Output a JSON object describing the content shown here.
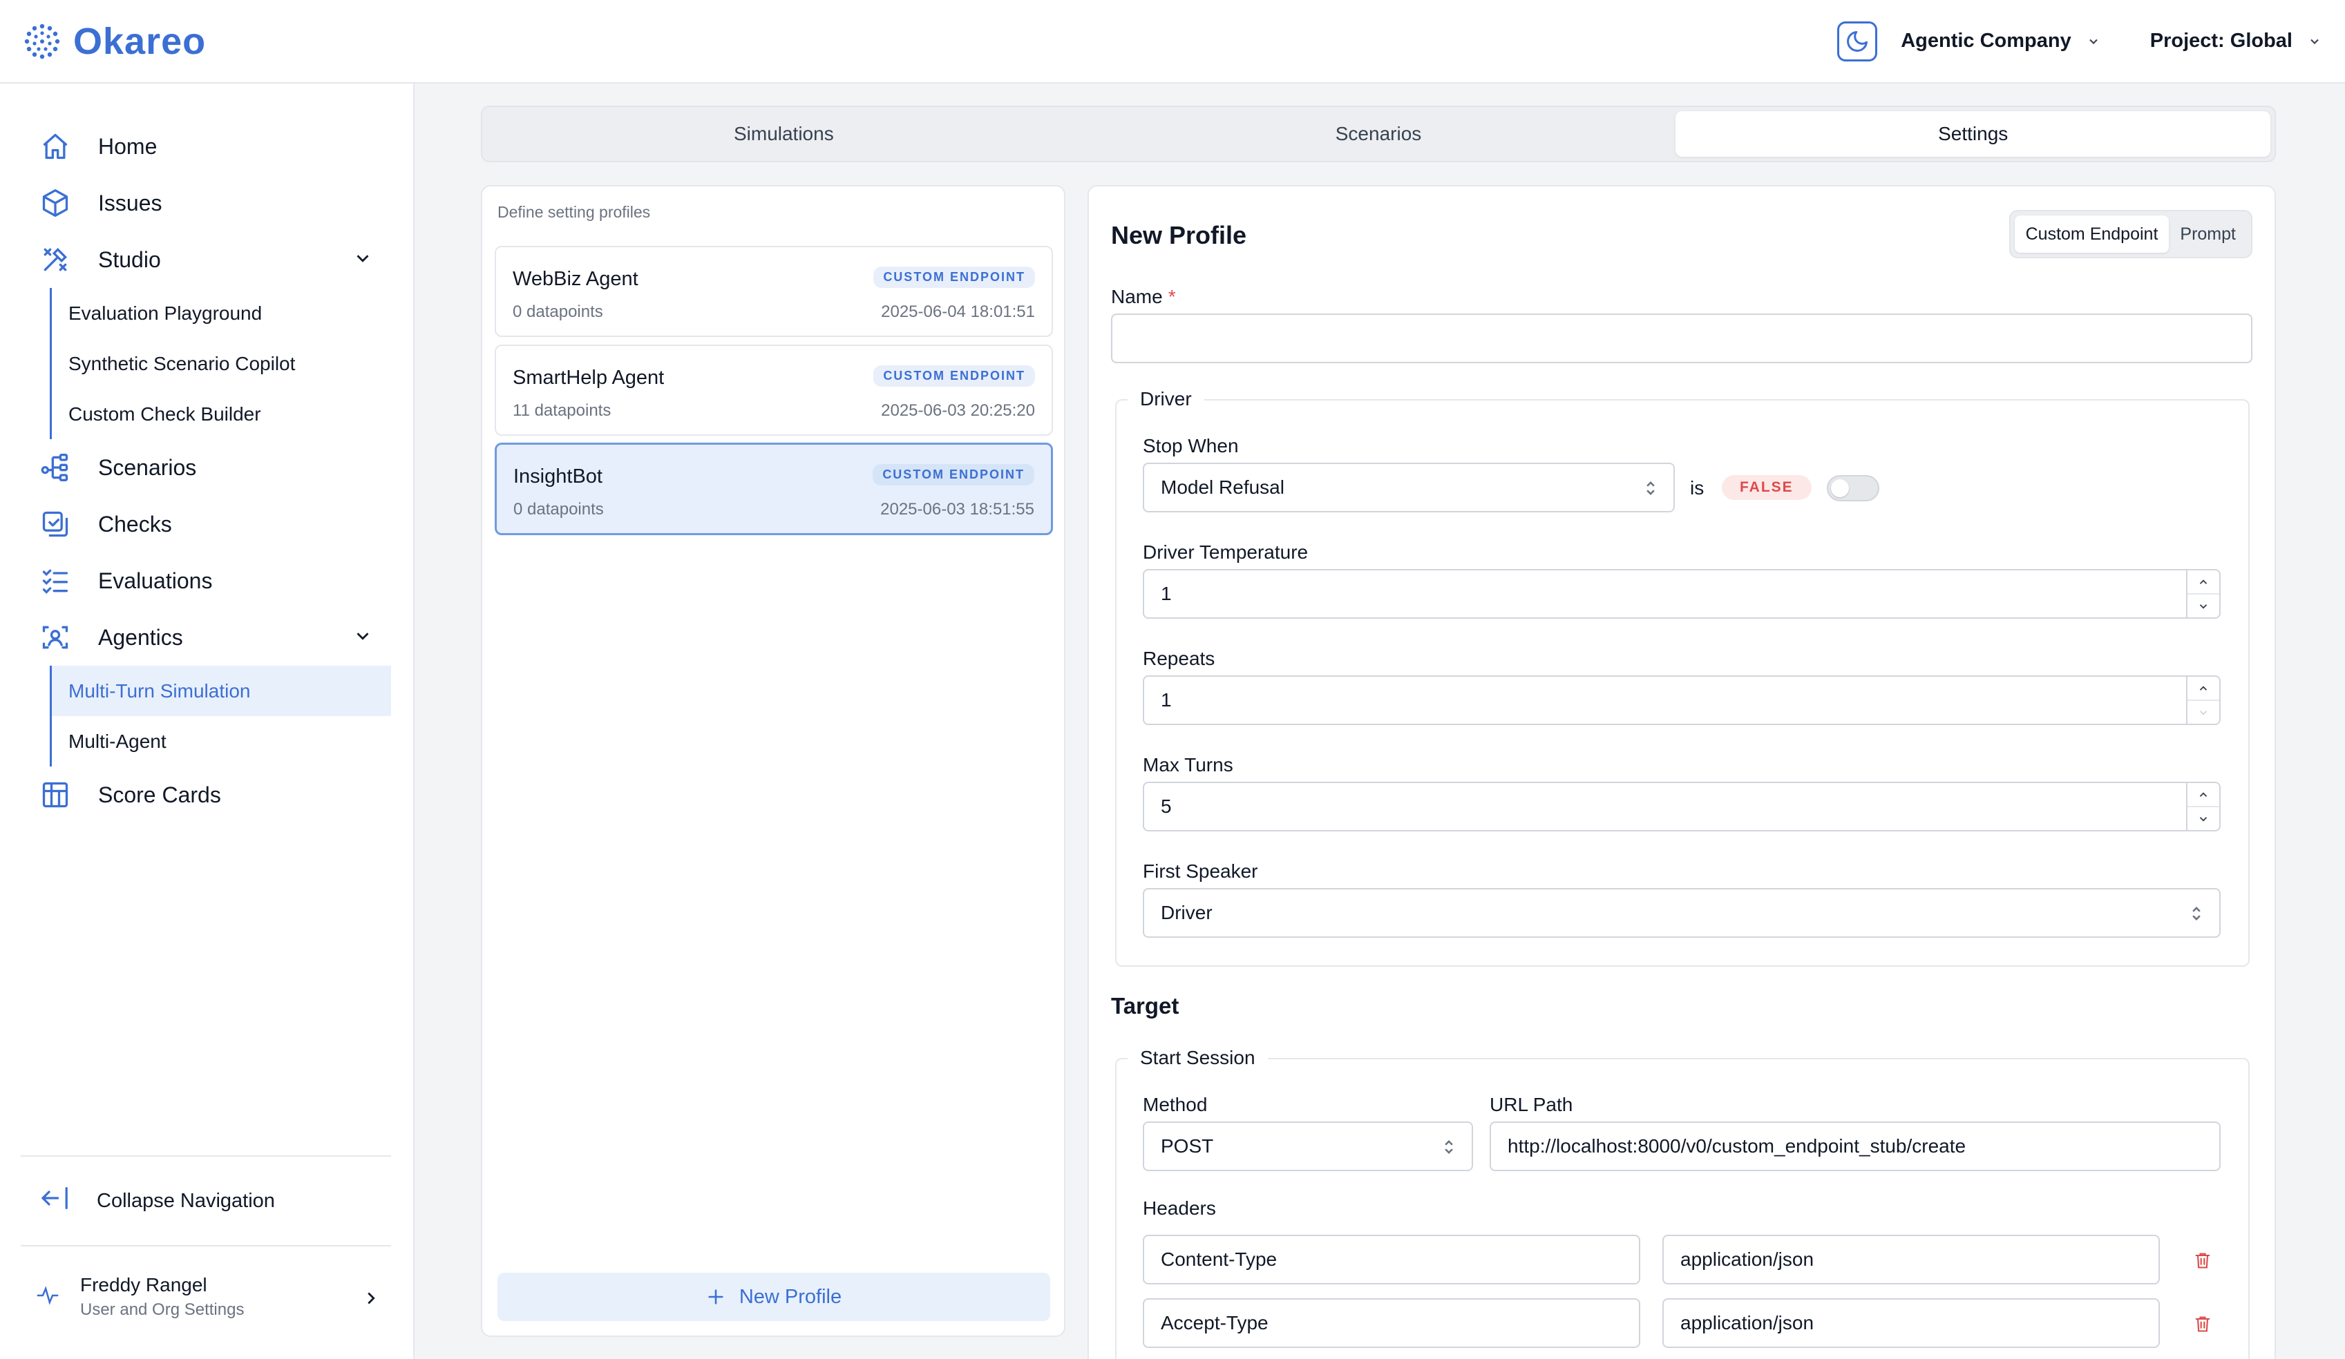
{
  "app": {
    "brand": "Okareo"
  },
  "topbar": {
    "org": "Agentic Company",
    "project": "Project: Global"
  },
  "sidebar": {
    "items": [
      {
        "label": "Home",
        "icon": "home-icon"
      },
      {
        "label": "Issues",
        "icon": "cube-icon"
      },
      {
        "label": "Studio",
        "icon": "tools-icon",
        "expanded": true,
        "children": [
          "Evaluation Playground",
          "Synthetic Scenario Copilot",
          "Custom Check Builder"
        ]
      },
      {
        "label": "Scenarios",
        "icon": "hierarchy-icon"
      },
      {
        "label": "Checks",
        "icon": "checks-icon"
      },
      {
        "label": "Evaluations",
        "icon": "list-check-icon"
      },
      {
        "label": "Agentics",
        "icon": "face-scan-icon",
        "expanded": true,
        "children": [
          "Multi-Turn Simulation",
          "Multi-Agent"
        ],
        "active_child": "Multi-Turn Simulation"
      },
      {
        "label": "Score Cards",
        "icon": "table-icon"
      }
    ],
    "collapse_label": "Collapse Navigation",
    "user": {
      "name": "Freddy Rangel",
      "subtitle": "User and Org Settings"
    }
  },
  "tabs": [
    {
      "label": "Simulations",
      "active": false
    },
    {
      "label": "Scenarios",
      "active": false
    },
    {
      "label": "Settings",
      "active": true
    }
  ],
  "profiles": {
    "hint": "Define setting profiles",
    "items": [
      {
        "name": "WebBiz Agent",
        "badge": "CUSTOM ENDPOINT",
        "count": "0 datapoints",
        "date": "2025-06-04 18:01:51",
        "active": false
      },
      {
        "name": "SmartHelp Agent",
        "badge": "CUSTOM ENDPOINT",
        "count": "11 datapoints",
        "date": "2025-06-03 20:25:20",
        "active": false
      },
      {
        "name": "InsightBot",
        "badge": "CUSTOM ENDPOINT",
        "count": "0 datapoints",
        "date": "2025-06-03 18:51:55",
        "active": true
      }
    ],
    "new_label": "New Profile"
  },
  "form": {
    "title": "New Profile",
    "mode_options": [
      "Custom Endpoint",
      "Prompt"
    ],
    "mode_selected": "Custom Endpoint",
    "name_label": "Name",
    "name_required": "*",
    "name_value": "",
    "driver": {
      "legend": "Driver",
      "stop_when_label": "Stop When",
      "stop_when_value": "Model Refusal",
      "is_text": "is",
      "bool_badge": "FALSE",
      "temperature_label": "Driver Temperature",
      "temperature_value": "1",
      "repeats_label": "Repeats",
      "repeats_value": "1",
      "max_turns_label": "Max Turns",
      "max_turns_value": "5",
      "first_speaker_label": "First Speaker",
      "first_speaker_value": "Driver"
    },
    "target": {
      "title": "Target",
      "legend": "Start Session",
      "method_label": "Method",
      "method_value": "POST",
      "url_label": "URL Path",
      "url_value": "http://localhost:8000/v0/custom_endpoint_stub/create",
      "headers_label": "Headers",
      "headers": [
        {
          "key": "Content-Type",
          "value": "application/json"
        },
        {
          "key": "Accept-Type",
          "value": "application/json"
        }
      ]
    }
  },
  "colors": {
    "accent": "#3b6fd4",
    "danger": "#dc4a4a",
    "active_bg": "#e8f0fc"
  }
}
